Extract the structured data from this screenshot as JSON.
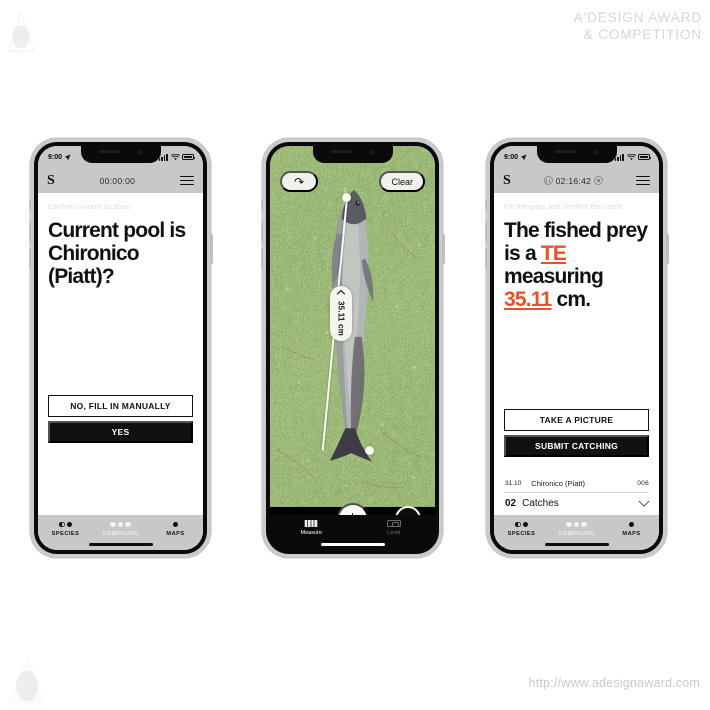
{
  "watermark": {
    "brand_line1": "A'DESIGN AWARD",
    "brand_line2": "& COMPETITION",
    "url": "http://www.adesignaward.com",
    "logo_name": "adesign-award-droplet-logo"
  },
  "phone1": {
    "status_bar": {
      "time": "9:00",
      "location_icon": "location-arrow-icon",
      "signal_icon": "cellular-signal-icon",
      "wifi_icon": "wifi-icon",
      "battery_icon": "battery-full-icon"
    },
    "app_bar": {
      "logo": "S",
      "timer": "00:00:00",
      "menu_icon": "hamburger-menu-icon"
    },
    "hint": "Confirm current location:",
    "headline": "Current pool is Chironico (Piatt)?",
    "buttons": {
      "secondary": "NO, FILL IN MANUALLY",
      "primary": "YES"
    },
    "tabs": [
      {
        "label": "SPECIES",
        "icon": "species-dots-icon",
        "active": false
      },
      {
        "label": "COMPILING",
        "icon": "compiling-dots-icon",
        "active": true
      },
      {
        "label": "MAPS",
        "icon": "maps-dot-icon",
        "active": false
      }
    ]
  },
  "phone2": {
    "app": "Measure",
    "undo_label": "↶",
    "undo_icon": "undo-arrow-icon",
    "clear_label": "Clear",
    "measurement": "35.11 cm",
    "chevron_icon": "chevron-up-icon",
    "add_point_icon": "plus-icon",
    "shutter_icon": "camera-shutter-icon",
    "tabs": [
      {
        "label": "Measure",
        "icon": "ruler-icon",
        "active": true
      },
      {
        "label": "Level",
        "icon": "level-icon",
        "active": false
      }
    ]
  },
  "phone3": {
    "status_bar": {
      "time": "9:00",
      "location_icon": "location-arrow-icon",
      "signal_icon": "cellular-signal-icon",
      "wifi_icon": "wifi-icon",
      "battery_icon": "battery-full-icon"
    },
    "app_bar": {
      "logo": "S",
      "timer": "02:16:42",
      "pause_icon": "pause-circle-icon",
      "stop_icon": "stop-circle-icon",
      "menu_icon": "hamburger-menu-icon"
    },
    "hint": "Fill the gaps and confirm the catch:",
    "headline_part1": "The fished prey is a ",
    "headline_species": "TE",
    "headline_part2": " measuring ",
    "headline_length": "35.11",
    "headline_part3": " cm.",
    "buttons": {
      "secondary": "TAKE A PICTURE",
      "primary": "SUBMIT CATCHING"
    },
    "catch_row": {
      "date": "31.10",
      "location": "Chironico (Piatt)",
      "number": "006"
    },
    "catches": {
      "count": "02",
      "label": "Catches",
      "chevron_icon": "chevron-down-icon"
    },
    "tabs": [
      {
        "label": "SPECIES",
        "icon": "species-dots-icon",
        "active": false
      },
      {
        "label": "COMPILING",
        "icon": "compiling-dots-icon",
        "active": true
      },
      {
        "label": "MAPS",
        "icon": "maps-dot-icon",
        "active": false
      }
    ]
  },
  "colors": {
    "accent": "#E8502A",
    "app_bar_gray": "#C8C8C8",
    "ink": "#111111"
  }
}
